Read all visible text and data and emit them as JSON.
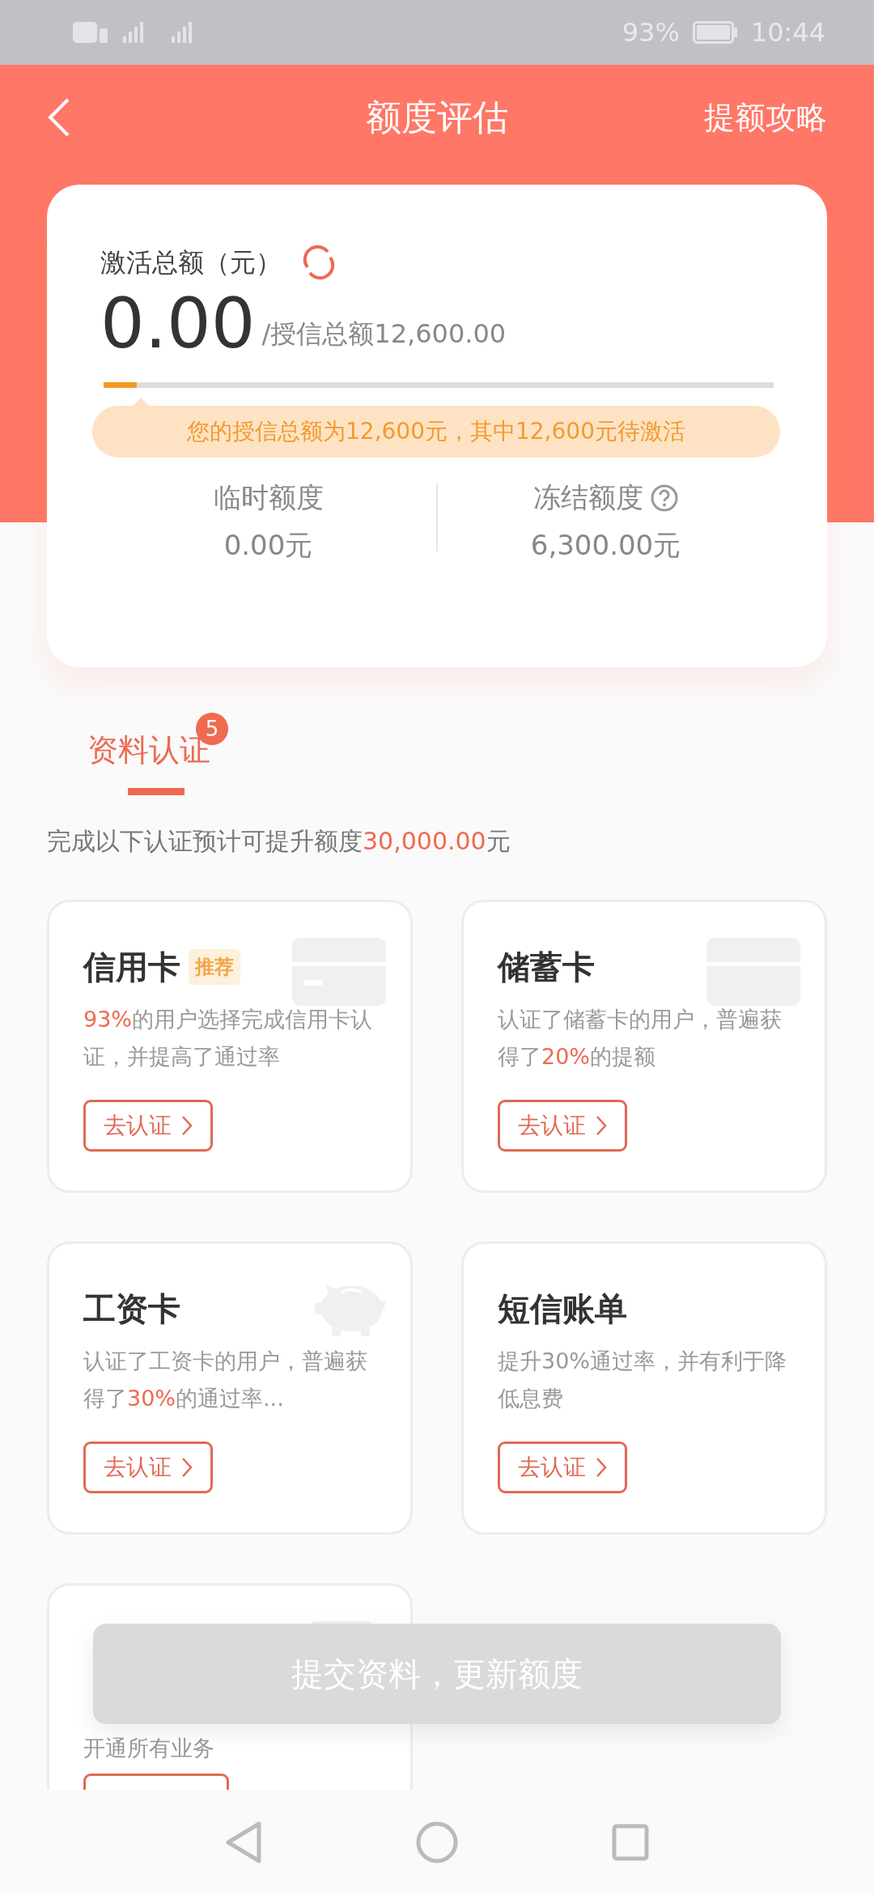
{
  "status_bar": {
    "battery": "93%",
    "time": "10:44"
  },
  "header": {
    "title": "额度评估",
    "action": "提额攻略"
  },
  "summary": {
    "label": "激活总额（元）",
    "amount": "0.00",
    "total": "/授信总额12,600.00",
    "level": 0.05,
    "tip": "您的授信总额为12,600元，其中12,600元待激活",
    "stats": [
      {
        "label": "临时额度",
        "value": "0.00元",
        "help": false
      },
      {
        "label": "冻结额度",
        "value": "6,300.00元",
        "help": true
      }
    ]
  },
  "tabs": [
    {
      "label": "资料认证",
      "selected": true,
      "badge": "5"
    }
  ],
  "subtitle": "完成以下认证预计可提升额度**30,000.00**元",
  "cards": [
    {
      "kind": "credit",
      "title": "信用卡",
      "tag": "推荐",
      "text": "**93%**的用户选择完成信用卡认证，并提高了通过率",
      "button": "去认证"
    },
    {
      "kind": "debit",
      "title": "储蓄卡",
      "text": "认证了储蓄卡的用户，普遍获得了**20%**的提额",
      "button": "去认证"
    },
    {
      "kind": "salary",
      "title": "工资卡",
      "text": "认证了工资卡的用户，普遍获得了**30%**的通过率...",
      "button": "去认证"
    },
    {
      "kind": "sms",
      "title": "短信账单",
      "text": "提升30%通过率，并有利于降低息费",
      "button": "去认证"
    },
    {
      "kind": "partial",
      "text": "开通所有业务"
    }
  ],
  "submit": {
    "label": "提交资料，更新额度",
    "disabled": true
  }
}
